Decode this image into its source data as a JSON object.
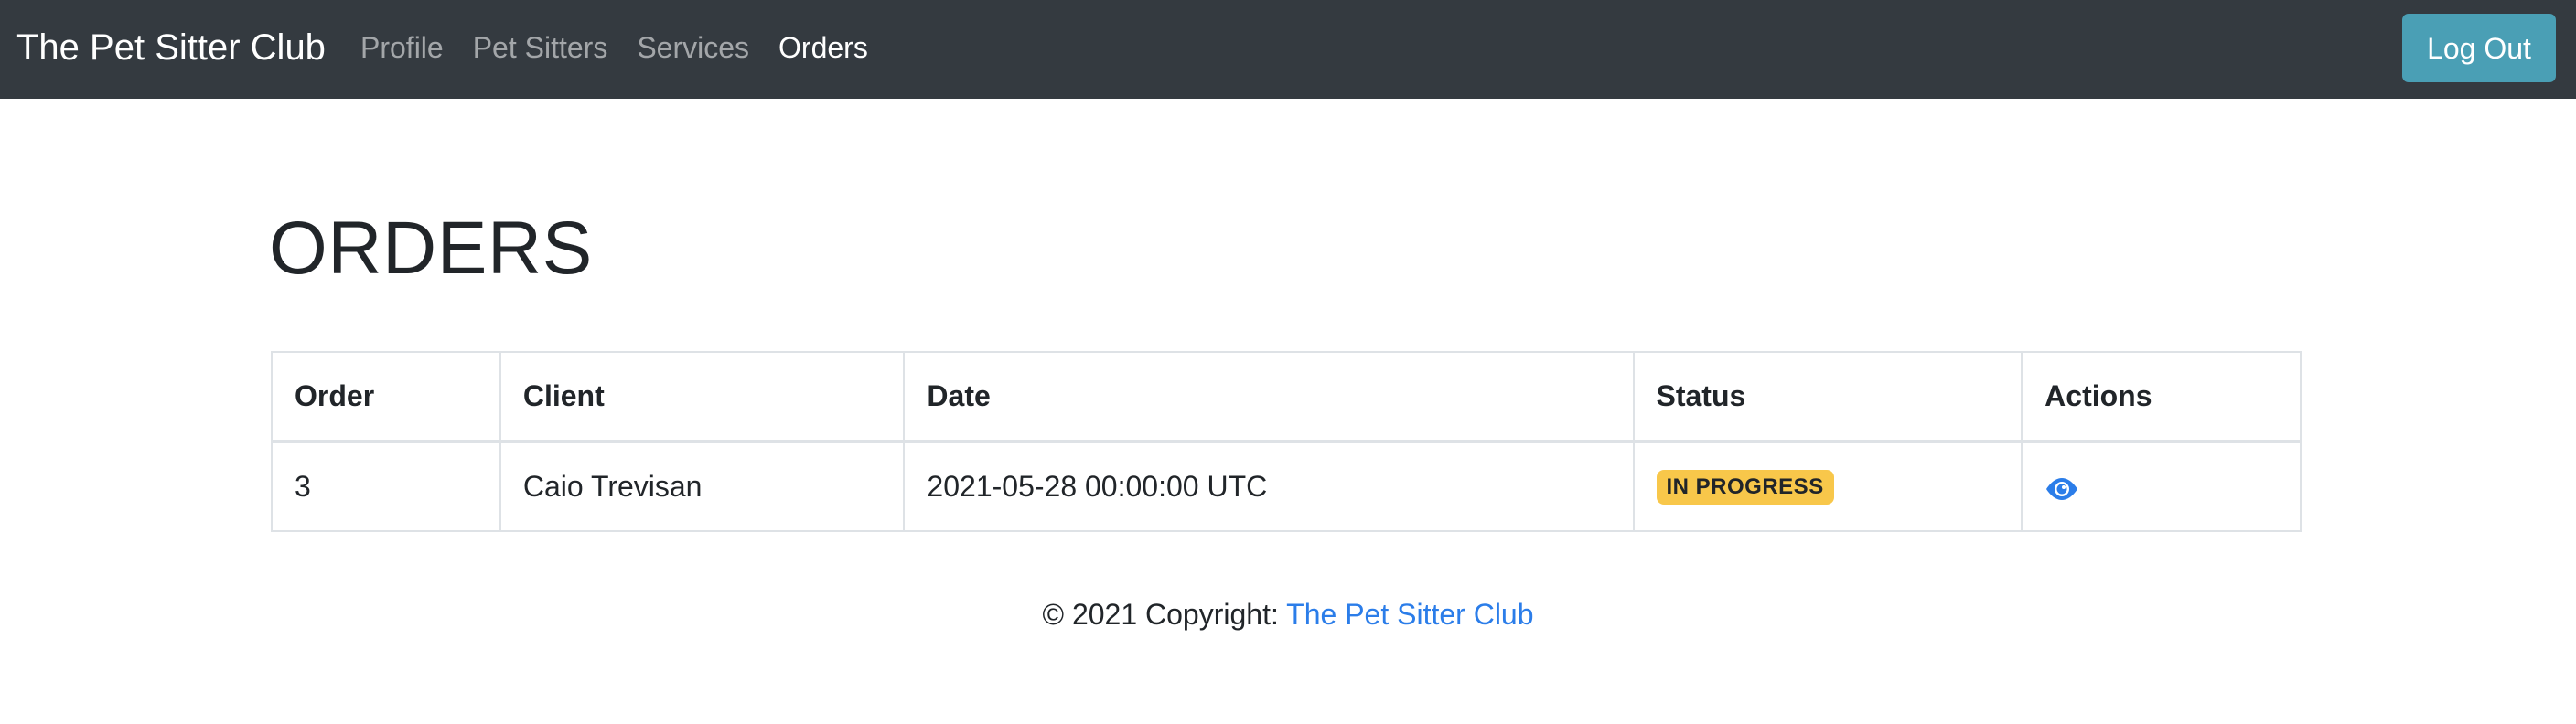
{
  "navbar": {
    "brand": "The Pet Sitter Club",
    "links": [
      {
        "label": "Profile",
        "active": false
      },
      {
        "label": "Pet Sitters",
        "active": false
      },
      {
        "label": "Services",
        "active": false
      },
      {
        "label": "Orders",
        "active": true
      }
    ],
    "logout_label": "Log Out"
  },
  "page": {
    "title": "ORDERS"
  },
  "table": {
    "headers": [
      "Order",
      "Client",
      "Date",
      "Status",
      "Actions"
    ],
    "rows": [
      {
        "order": "3",
        "client": "Caio Trevisan",
        "date": "2021-05-28 00:00:00 UTC",
        "status": "IN PROGRESS",
        "action_icon": "eye-icon"
      }
    ]
  },
  "footer": {
    "copyright_prefix": "© 2021 Copyright: ",
    "link_label": "The Pet Sitter Club"
  },
  "colors": {
    "navbar_bg": "#343a40",
    "logout_button": "#4a9fb5",
    "status_badge": "#f8c74a",
    "link": "#2b7de9"
  }
}
